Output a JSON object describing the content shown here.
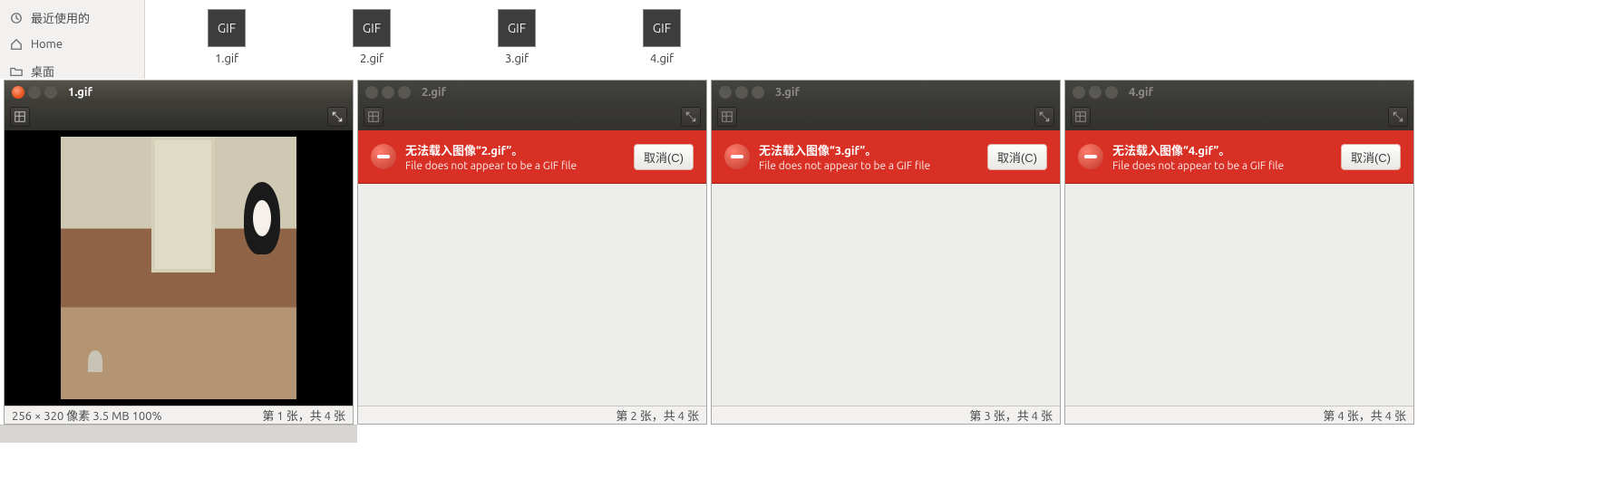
{
  "sidebar": {
    "items": [
      {
        "label": "最近使用的"
      },
      {
        "label": "Home"
      },
      {
        "label": "桌面"
      }
    ]
  },
  "files": [
    {
      "thumb_text": "GIF",
      "name": "1.gif"
    },
    {
      "thumb_text": "GIF",
      "name": "2.gif"
    },
    {
      "thumb_text": "GIF",
      "name": "3.gif"
    },
    {
      "thumb_text": "GIF",
      "name": "4.gif"
    }
  ],
  "viewers": [
    {
      "title": "1.gif",
      "status_left": "256 × 320 像素  3.5 MB   100%",
      "status_right": "第 1 张，共 4 张"
    },
    {
      "title": "2.gif",
      "error_title": "无法载入图像“2.gif”。",
      "error_sub": "File does not appear to be a GIF file",
      "cancel": "取消(C)",
      "status_right": "第 2 张，共 4 张"
    },
    {
      "title": "3.gif",
      "error_title": "无法载入图像“3.gif”。",
      "error_sub": "File does not appear to be a GIF file",
      "cancel": "取消(C)",
      "status_right": "第 3 张，共 4 张"
    },
    {
      "title": "4.gif",
      "error_title": "无法载入图像“4.gif”。",
      "error_sub": "File does not appear to be a GIF file",
      "cancel": "取消(C)",
      "status_right": "第 4 张，共 4 张"
    }
  ]
}
